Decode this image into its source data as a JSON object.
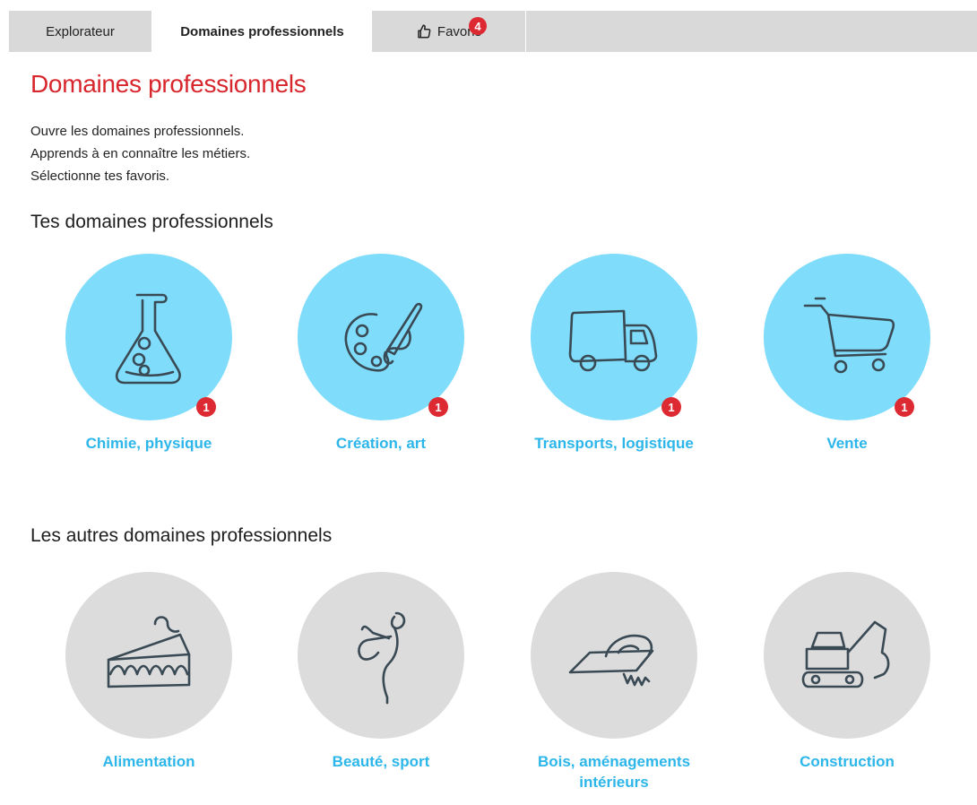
{
  "tabs": {
    "explorer": "Explorateur",
    "domains": "Domaines professionnels",
    "favoris": "Favoris",
    "favoris_count": "4"
  },
  "page": {
    "title": "Domaines professionnels",
    "intro": [
      "Ouvre les domaines professionnels.",
      "Apprends à en connaître les métiers.",
      "Sélectionne tes favoris."
    ]
  },
  "favorites_section": {
    "heading": "Tes domaines professionnels",
    "items": [
      {
        "label": "Chimie, physique",
        "count": "1",
        "icon": "flask-icon"
      },
      {
        "label": "Création, art",
        "count": "1",
        "icon": "palette-icon"
      },
      {
        "label": "Transports, logistique",
        "count": "1",
        "icon": "truck-icon"
      },
      {
        "label": "Vente",
        "count": "1",
        "icon": "cart-icon"
      }
    ]
  },
  "others_section": {
    "heading": "Les autres domaines professionnels",
    "items": [
      {
        "label": "Alimentation",
        "icon": "cake-icon"
      },
      {
        "label": "Beauté, sport",
        "icon": "dancer-icon"
      },
      {
        "label": "Bois, aménagements intérieurs",
        "icon": "saw-icon"
      },
      {
        "label": "Construction",
        "icon": "excavator-icon"
      }
    ]
  },
  "colors": {
    "title_red": "#d8262d",
    "badge_red": "#dd2a32",
    "favorite_circle": "#7fdcfb",
    "other_circle": "#dcdcdc",
    "label_blue": "#2cb6ea",
    "icon_stroke": "#3a4a55"
  }
}
